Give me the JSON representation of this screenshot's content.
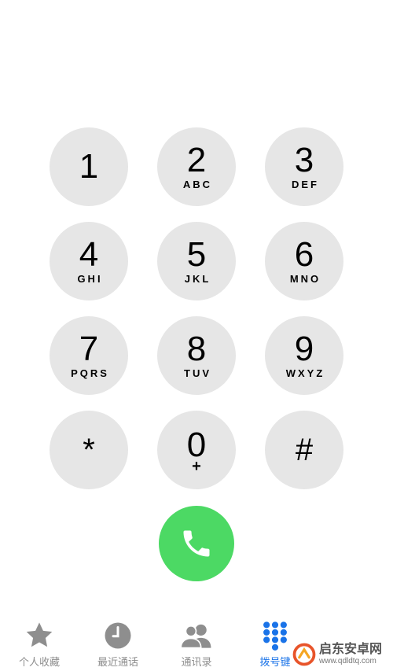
{
  "keypad": {
    "keys": [
      {
        "digit": "1",
        "letters": ""
      },
      {
        "digit": "2",
        "letters": "ABC"
      },
      {
        "digit": "3",
        "letters": "DEF"
      },
      {
        "digit": "4",
        "letters": "GHI"
      },
      {
        "digit": "5",
        "letters": "JKL"
      },
      {
        "digit": "6",
        "letters": "MNO"
      },
      {
        "digit": "7",
        "letters": "PQRS"
      },
      {
        "digit": "8",
        "letters": "TUV"
      },
      {
        "digit": "9",
        "letters": "WXYZ"
      },
      {
        "digit": "*",
        "letters": ""
      },
      {
        "digit": "0",
        "letters": "+"
      },
      {
        "digit": "#",
        "letters": ""
      }
    ]
  },
  "call": {
    "icon": "phone-icon",
    "color": "#4cd964"
  },
  "tabs": [
    {
      "label": "个人收藏",
      "icon": "star-icon",
      "active": false
    },
    {
      "label": "最近通话",
      "icon": "clock-icon",
      "active": false
    },
    {
      "label": "通讯录",
      "icon": "contacts-icon",
      "active": false
    },
    {
      "label": "拨号键",
      "icon": "keypad-icon",
      "active": true
    }
  ],
  "watermark": {
    "name": "启东安卓网",
    "url": "www.qdldtq.com"
  },
  "colors": {
    "key_bg": "#e6e6e6",
    "active_tab": "#1a73e8",
    "inactive_tab": "#8e8e8e"
  }
}
